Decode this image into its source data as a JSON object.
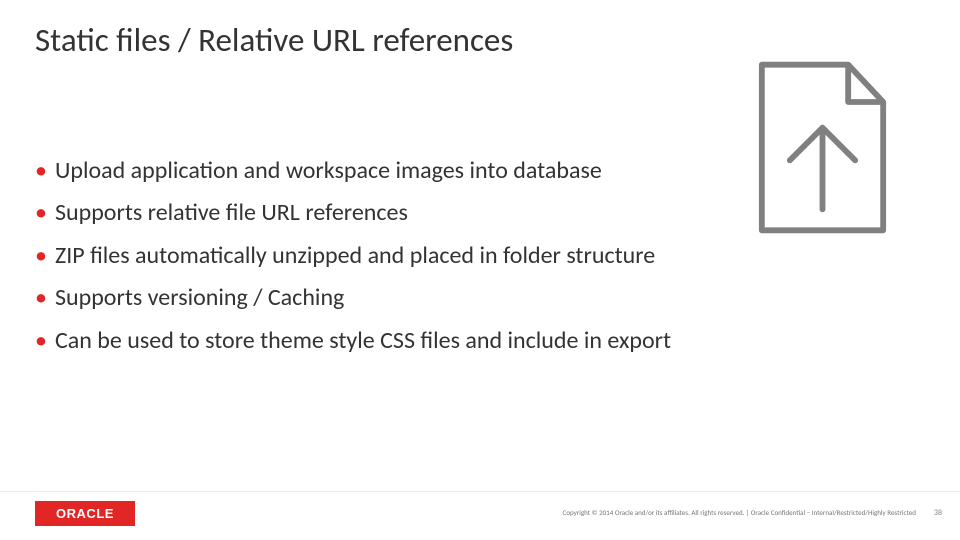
{
  "title": "Static files / Relative URL references",
  "bullets": [
    "Upload application and workspace images into database",
    "Supports relative file URL references",
    "ZIP files automatically unzipped and placed in folder structure",
    "Supports versioning / Caching",
    "Can be used to store theme style CSS files and include in export"
  ],
  "footer": {
    "logo_text": "ORACLE",
    "copyright": "Copyright © 2014 Oracle and/or its affiliates. All rights reserved.   |   Oracle Confidential – Internal/Restricted/Highly Restricted",
    "page_number": "38"
  },
  "colors": {
    "accent": "#e22626",
    "text": "#333333",
    "muted": "#777777"
  }
}
